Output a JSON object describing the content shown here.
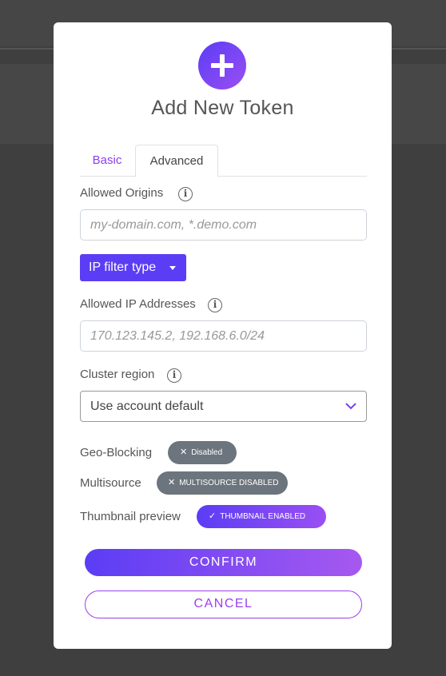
{
  "modal": {
    "title": "Add New Token",
    "tabs": [
      {
        "label": "Basic",
        "active": false
      },
      {
        "label": "Advanced",
        "active": true
      }
    ]
  },
  "fields": {
    "allowed_origins": {
      "label": "Allowed Origins",
      "placeholder": "my-domain.com, *.demo.com",
      "value": ""
    },
    "ip_filter": {
      "label": "IP filter type"
    },
    "allowed_ips": {
      "label": "Allowed IP Addresses",
      "placeholder": "170.123.145.2, 192.168.6.0/24",
      "value": ""
    },
    "cluster_region": {
      "label": "Cluster region",
      "selected": "Use account default"
    }
  },
  "toggles": {
    "geo_blocking": {
      "label": "Geo-Blocking",
      "state_text": "Disabled",
      "enabled": false
    },
    "multisource": {
      "label": "Multisource",
      "state_text": "MULTISOURCE DISABLED",
      "enabled": false
    },
    "thumbnail": {
      "label": "Thumbnail preview",
      "state_text": "THUMBNAIL ENABLED",
      "enabled": true
    }
  },
  "actions": {
    "confirm": "CONFIRM",
    "cancel": "CANCEL"
  },
  "icons": {
    "header": "plus-icon",
    "info": "info-icon",
    "select": "chevron-down-icon",
    "disabled": "x-icon",
    "enabled": "check-icon"
  },
  "colors": {
    "accent": "#5b3df5",
    "accent_gradient_end": "#9a4ff2",
    "tab_active_text": "#8a3ff0",
    "pill_disabled": "#6c757d",
    "backdrop": "#3f3f3f"
  }
}
